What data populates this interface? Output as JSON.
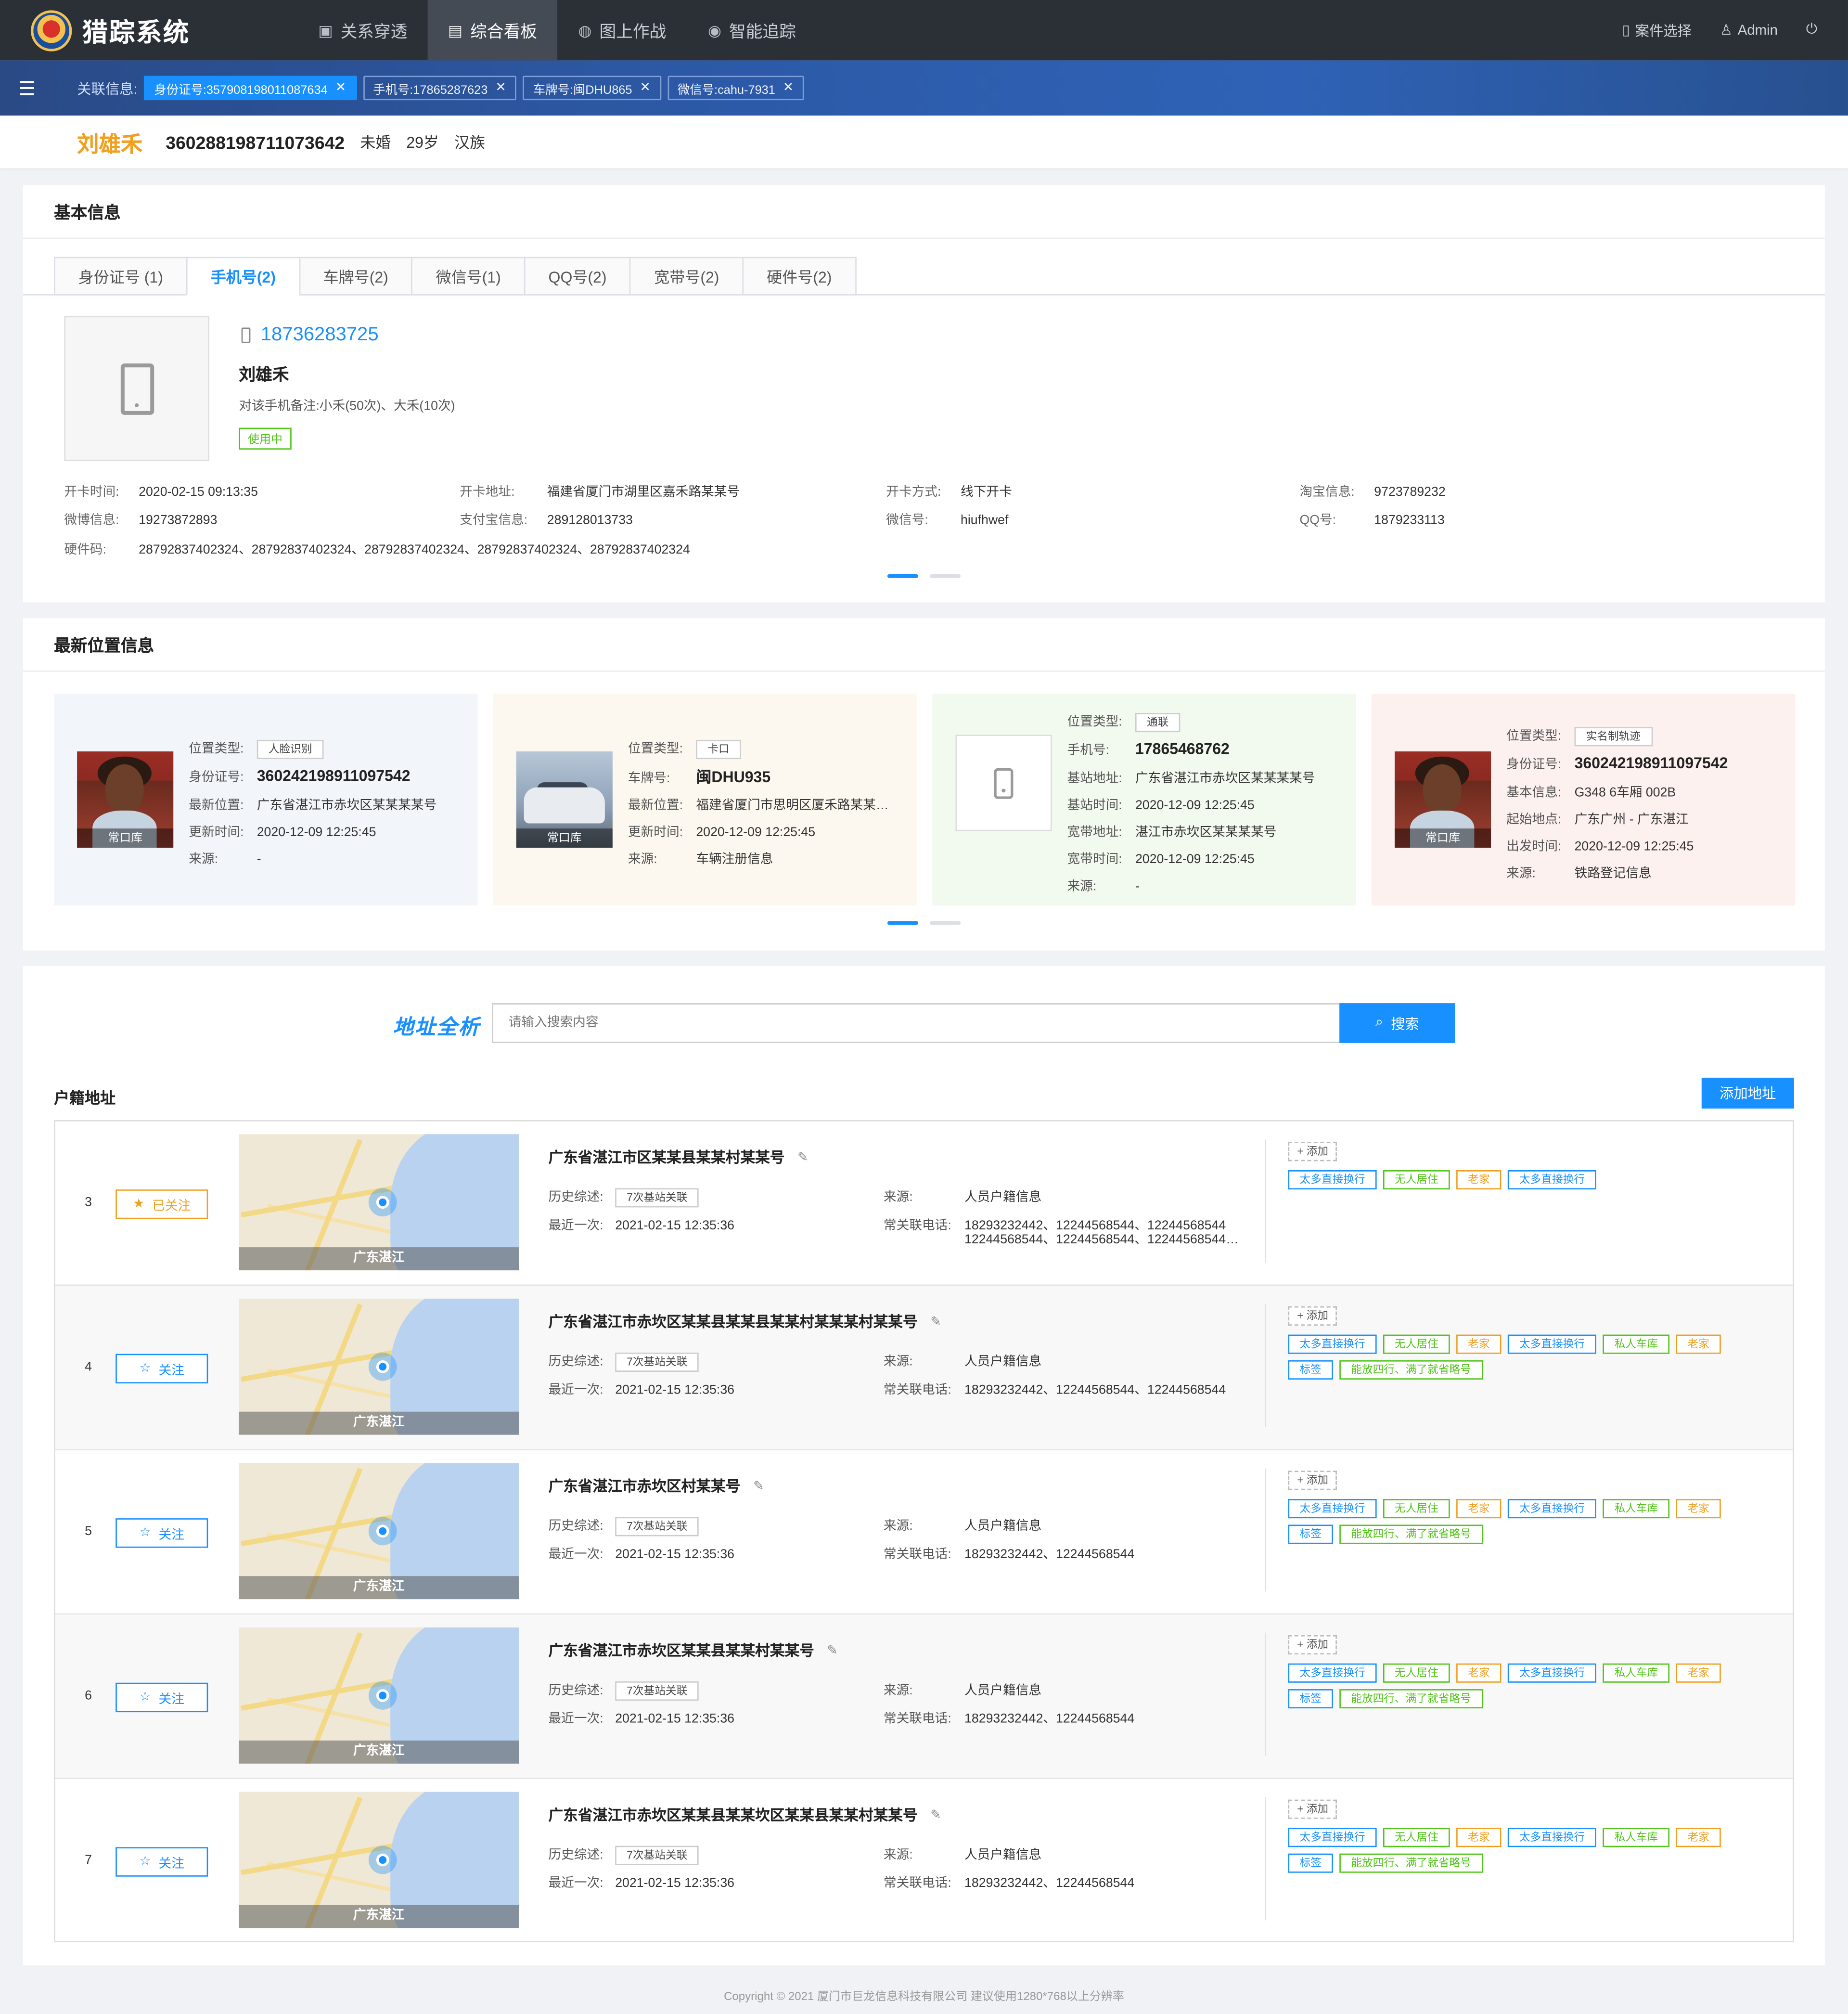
{
  "app": {
    "title": "猎踪系统"
  },
  "nav": [
    {
      "label": "关系穿透",
      "icon": "relation-icon"
    },
    {
      "label": "综合看板",
      "icon": "dashboard-icon"
    },
    {
      "label": "图上作战",
      "icon": "map-battle-icon"
    },
    {
      "label": "智能追踪",
      "icon": "tracking-icon"
    }
  ],
  "header_right": {
    "case_select": "案件选择",
    "user": "Admin"
  },
  "related": {
    "label": "关联信息:",
    "chips": [
      "身份证号:357908198011087634",
      "手机号:17865287623",
      "车牌号:闽DHU865",
      "微信号:cahu-7931"
    ]
  },
  "person": {
    "name": "刘雄禾",
    "id": "360288198711073642",
    "marital": "未婚",
    "age": "29岁",
    "ethnic": "汉族"
  },
  "basic": {
    "title": "基本信息",
    "tabs": [
      "身份证号 (1)",
      "手机号(2)",
      "车牌号(2)",
      "微信号(1)",
      "QQ号(2)",
      "宽带号(2)",
      "硬件号(2)"
    ],
    "phone": "18736283725",
    "owner": "刘雄禾",
    "note": "对该手机备注:小禾(50次)、大禾(10次)",
    "status": "使用中",
    "fields": {
      "open_time_k": "开卡时间:",
      "open_time_v": "2020-02-15   09:13:35",
      "open_addr_k": "开卡地址:",
      "open_addr_v": "福建省厦门市湖里区嘉禾路某某号",
      "open_way_k": "开卡方式:",
      "open_way_v": "线下开卡",
      "taobao_k": "淘宝信息:",
      "taobao_v": "9723789232",
      "weibo_k": "微博信息:",
      "weibo_v": "19273872893",
      "alipay_k": "支付宝信息:",
      "alipay_v": "289128013733",
      "wechat_k": "微信号:",
      "wechat_v": "hiufhwef",
      "qq_k": "QQ号:",
      "qq_v": "1879233113",
      "hw_k": "硬件码:",
      "hw_v": "28792837402324、28792837402324、28792837402324、28792837402324、28792837402324"
    }
  },
  "location": {
    "title": "最新位置信息",
    "cards": [
      {
        "type_k": "位置类型:",
        "type_v": "人脸识别",
        "r1k": "身份证号:",
        "r1v": "360242198911097542",
        "r2k": "最新位置:",
        "r2v": "广东省湛江市赤坎区某某某某号",
        "r3k": "更新时间:",
        "r3v": "2020-12-09  12:25:45",
        "r4k": "来源:",
        "r4v": "-",
        "img_tag": "常口库"
      },
      {
        "type_k": "位置类型:",
        "type_v": "卡口",
        "r1k": "车牌号:",
        "r1v": "闽DHU935",
        "r2k": "最新位置:",
        "r2v": "福建省厦门市思明区厦禾路某某…",
        "r3k": "更新时间:",
        "r3v": "2020-12-09  12:25:45",
        "r4k": "来源:",
        "r4v": "车辆注册信息",
        "img_tag": "常口库"
      },
      {
        "type_k": "位置类型:",
        "type_v": "通联",
        "r1k": "手机号:",
        "r1v": "17865468762",
        "r2k": "基站地址:",
        "r2v": "广东省湛江市赤坎区某某某某号",
        "r3k": "基站时间:",
        "r3v": "2020-12-09  12:25:45",
        "r4k": "宽带地址:",
        "r4v": "湛江市赤坎区某某某某号",
        "r5k": "宽带时间:",
        "r5v": "2020-12-09  12:25:45",
        "r6k": "来源:",
        "r6v": "-"
      },
      {
        "type_k": "位置类型:",
        "type_v": "实名制轨迹",
        "r1k": "身份证号:",
        "r1v": "360242198911097542",
        "r2k": "基本信息:",
        "r2v": "G348   6车厢   002B",
        "r3k": "起始地点:",
        "r3v": "广东广州 - 广东湛江",
        "r4k": "出发时间:",
        "r4v": "2020-12-09  12:25:45",
        "r5k": "来源:",
        "r5v": "铁路登记信息",
        "img_tag": "常口库"
      }
    ],
    "colors": [
      "#f2f6fb",
      "#fdf8ef",
      "#f2f9ee",
      "#fdf1ef"
    ]
  },
  "address": {
    "title": "地址全析",
    "search_placeholder": "请输入搜索内容",
    "search_btn": "搜索",
    "section": "户籍地址",
    "add_btn": "添加地址",
    "add_tag": "+ 添加",
    "rows": [
      {
        "no": "3",
        "follow": "已关注",
        "followed": true,
        "map_caption": "广东湛江",
        "addr": "广东省湛江市区某某县某某村某某号",
        "hist_k": "历史综述:",
        "hist_v": "7次基站关联",
        "last_k": "最近一次:",
        "last_v": "2021-02-15  12:35:36",
        "src_k": "来源:",
        "src_v": "人员户籍信息",
        "tel_k": "常关联电话:",
        "tel_v": "18293232442、12244568544、12244568544",
        "tel_v2": "12244568544、12244568544、12244568544…",
        "tags": [
          [
            "太多直接换行",
            "blue"
          ],
          [
            "无人居住",
            "green"
          ],
          [
            "老家",
            "orange"
          ],
          [
            "太多直接换行",
            "blue"
          ]
        ]
      },
      {
        "no": "4",
        "follow": "关注",
        "followed": false,
        "map_caption": "广东湛江",
        "addr": "广东省湛江市赤坎区某某县某某县某某村某某某村某某号",
        "hist_k": "历史综述:",
        "hist_v": "7次基站关联",
        "last_k": "最近一次:",
        "last_v": "2021-02-15  12:35:36",
        "src_k": "来源:",
        "src_v": "人员户籍信息",
        "tel_k": "常关联电话:",
        "tel_v": "18293232442、12244568544、12244568544",
        "tel_v2": "",
        "tags": [
          [
            "太多直接换行",
            "blue"
          ],
          [
            "无人居住",
            "green"
          ],
          [
            "老家",
            "orange"
          ],
          [
            "太多直接换行",
            "blue"
          ],
          [
            "私人车库",
            "green"
          ],
          [
            "老家",
            "orange"
          ],
          [
            "标签",
            "blue"
          ],
          [
            "能放四行、满了就省略号",
            "green"
          ]
        ]
      },
      {
        "no": "5",
        "follow": "关注",
        "followed": false,
        "map_caption": "广东湛江",
        "addr": "广东省湛江市赤坎区村某某号",
        "hist_k": "历史综述:",
        "hist_v": "7次基站关联",
        "last_k": "最近一次:",
        "last_v": "2021-02-15  12:35:36",
        "src_k": "来源:",
        "src_v": "人员户籍信息",
        "tel_k": "常关联电话:",
        "tel_v": "18293232442、12244568544",
        "tel_v2": "",
        "tags": [
          [
            "太多直接换行",
            "blue"
          ],
          [
            "无人居住",
            "green"
          ],
          [
            "老家",
            "orange"
          ],
          [
            "太多直接换行",
            "blue"
          ],
          [
            "私人车库",
            "green"
          ],
          [
            "老家",
            "orange"
          ],
          [
            "标签",
            "blue"
          ],
          [
            "能放四行、满了就省略号",
            "green"
          ]
        ]
      },
      {
        "no": "6",
        "follow": "关注",
        "followed": false,
        "map_caption": "广东湛江",
        "addr": "广东省湛江市赤坎区某某县某某村某某号",
        "hist_k": "历史综述:",
        "hist_v": "7次基站关联",
        "last_k": "最近一次:",
        "last_v": "2021-02-15  12:35:36",
        "src_k": "来源:",
        "src_v": "人员户籍信息",
        "tel_k": "常关联电话:",
        "tel_v": "18293232442、12244568544",
        "tel_v2": "",
        "tags": [
          [
            "太多直接换行",
            "blue"
          ],
          [
            "无人居住",
            "green"
          ],
          [
            "老家",
            "orange"
          ],
          [
            "太多直接换行",
            "blue"
          ],
          [
            "私人车库",
            "green"
          ],
          [
            "老家",
            "orange"
          ],
          [
            "标签",
            "blue"
          ],
          [
            "能放四行、满了就省略号",
            "green"
          ]
        ]
      },
      {
        "no": "7",
        "follow": "关注",
        "followed": false,
        "map_caption": "广东湛江",
        "addr": "广东省湛江市赤坎区某某县某某坎区某某县某某村某某号",
        "hist_k": "历史综述:",
        "hist_v": "7次基站关联",
        "last_k": "最近一次:",
        "last_v": "2021-02-15  12:35:36",
        "src_k": "来源:",
        "src_v": "人员户籍信息",
        "tel_k": "常关联电话:",
        "tel_v": "18293232442、12244568544",
        "tel_v2": "",
        "tags": [
          [
            "太多直接换行",
            "blue"
          ],
          [
            "无人居住",
            "green"
          ],
          [
            "老家",
            "orange"
          ],
          [
            "太多直接换行",
            "blue"
          ],
          [
            "私人车库",
            "green"
          ],
          [
            "老家",
            "orange"
          ],
          [
            "标签",
            "blue"
          ],
          [
            "能放四行、满了就省略号",
            "green"
          ]
        ]
      }
    ]
  },
  "footer": "Copyright © 2021  厦门市巨龙信息科技有限公司  建议使用1280*768以上分辨率"
}
